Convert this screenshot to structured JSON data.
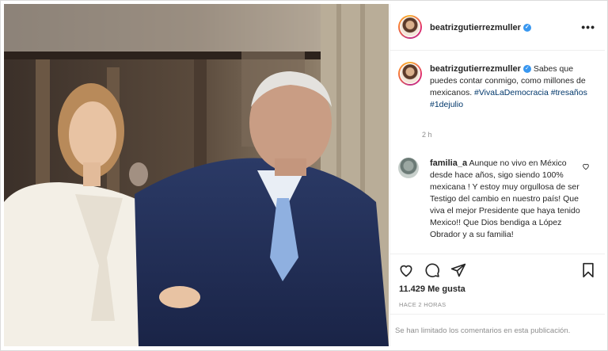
{
  "post": {
    "username": "beatrizgutierrezmuller",
    "verified_badge": "verified-check-icon",
    "more_label": "•••",
    "caption_text": "Sabes que puedes contar conmigo, como millones de mexicanos.",
    "hashtags": [
      "#VivaLaDemocracia",
      "#tresaños",
      "#1dejulio"
    ],
    "caption_time": "2 h"
  },
  "comment": {
    "username": "familia_a",
    "text": "Aunque no vivo en México desde hace años, sigo siendo 100% mexicana ! Y estoy muy orgullosa de ser Testigo del cambio en nuestro país! Que viva el mejor Presidente que haya tenido Mexico!! Que Dios bendiga a López Obrador y a su familia!"
  },
  "actions": {
    "icons": [
      "heart-icon",
      "comment-icon",
      "share-icon",
      "bookmark-icon"
    ],
    "likes_label": "11.429 Me gusta",
    "time_ago": "HACE 2 HORAS",
    "comments_limited": "Se han limitado los comentarios en esta publicación."
  },
  "colors": {
    "link": "#00376b",
    "verified": "#3897f0",
    "muted": "#8e8e8e"
  }
}
